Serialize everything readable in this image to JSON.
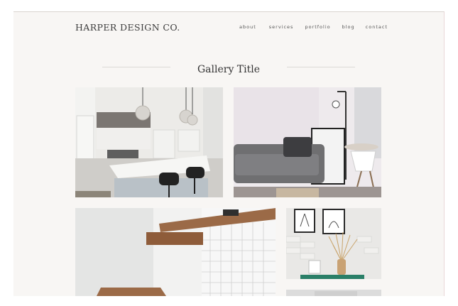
{
  "header": {
    "brand": "HARPER DESIGN CO.",
    "nav": [
      "about",
      "services",
      "portfolio",
      "blog",
      "contact"
    ]
  },
  "gallery": {
    "title": "Gallery Title",
    "images": [
      "kitchen-photo",
      "living-room-photo",
      "shelves-photo",
      "wall-decor-photo",
      "partial-photo"
    ]
  },
  "colors": {
    "background": "#f8f6f4",
    "text": "#3c3c3c"
  }
}
